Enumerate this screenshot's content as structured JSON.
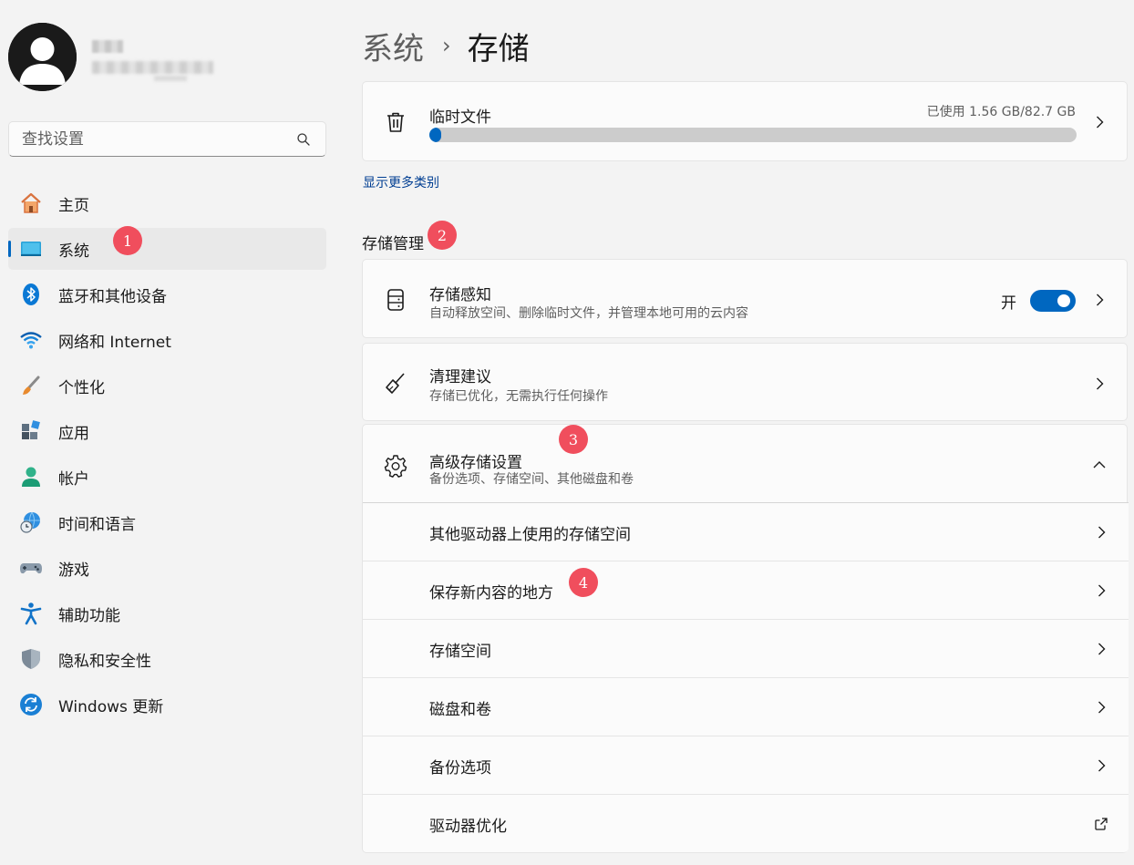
{
  "sidebar": {
    "search_placeholder": "查找设置",
    "items": [
      {
        "label": "主页",
        "icon": "home-icon"
      },
      {
        "label": "系统",
        "icon": "system-display-icon",
        "active": true
      },
      {
        "label": "蓝牙和其他设备",
        "icon": "bluetooth-icon"
      },
      {
        "label": "网络和 Internet",
        "icon": "wifi-icon"
      },
      {
        "label": "个性化",
        "icon": "brush-icon"
      },
      {
        "label": "应用",
        "icon": "apps-icon"
      },
      {
        "label": "帐户",
        "icon": "account-icon"
      },
      {
        "label": "时间和语言",
        "icon": "globe-clock-icon"
      },
      {
        "label": "游戏",
        "icon": "gamepad-icon"
      },
      {
        "label": "辅助功能",
        "icon": "accessibility-icon"
      },
      {
        "label": "隐私和安全性",
        "icon": "shield-icon"
      },
      {
        "label": "Windows 更新",
        "icon": "windows-update-icon"
      }
    ]
  },
  "breadcrumb": {
    "parent": "系统",
    "separator": "›",
    "current": "存储"
  },
  "temp_files": {
    "title": "临时文件",
    "usage": "已使用 1.56 GB/82.7 GB",
    "used_fraction": 0.019,
    "icon": "trash-icon"
  },
  "show_more_link": "显示更多类别",
  "storage_management": {
    "section_label": "存储管理",
    "storage_sense": {
      "title": "存储感知",
      "subtitle": "自动释放空间、删除临时文件，并管理本地可用的云内容",
      "toggle_label": "开",
      "toggle_on": true,
      "icon": "storage-drive-icon"
    },
    "cleanup": {
      "title": "清理建议",
      "subtitle": "存储已优化，无需执行任何操作",
      "icon": "broom-icon"
    },
    "advanced": {
      "title": "高级存储设置",
      "subtitle": "备份选项、存储空间、其他磁盘和卷",
      "icon": "gear-icon",
      "expanded": true,
      "items": [
        {
          "label": "其他驱动器上使用的存储空间",
          "action": "chevron-right-icon"
        },
        {
          "label": "保存新内容的地方",
          "action": "chevron-right-icon"
        },
        {
          "label": "存储空间",
          "action": "chevron-right-icon"
        },
        {
          "label": "磁盘和卷",
          "action": "chevron-right-icon"
        },
        {
          "label": "备份选项",
          "action": "chevron-right-icon"
        },
        {
          "label": "驱动器优化",
          "action": "external-link-icon"
        }
      ]
    }
  },
  "badges": [
    "1",
    "2",
    "3",
    "4"
  ],
  "colors": {
    "accent": "#0067c0",
    "badge": "#f04e5d",
    "background": "#f3f3f3",
    "card": "#fbfbfb"
  }
}
